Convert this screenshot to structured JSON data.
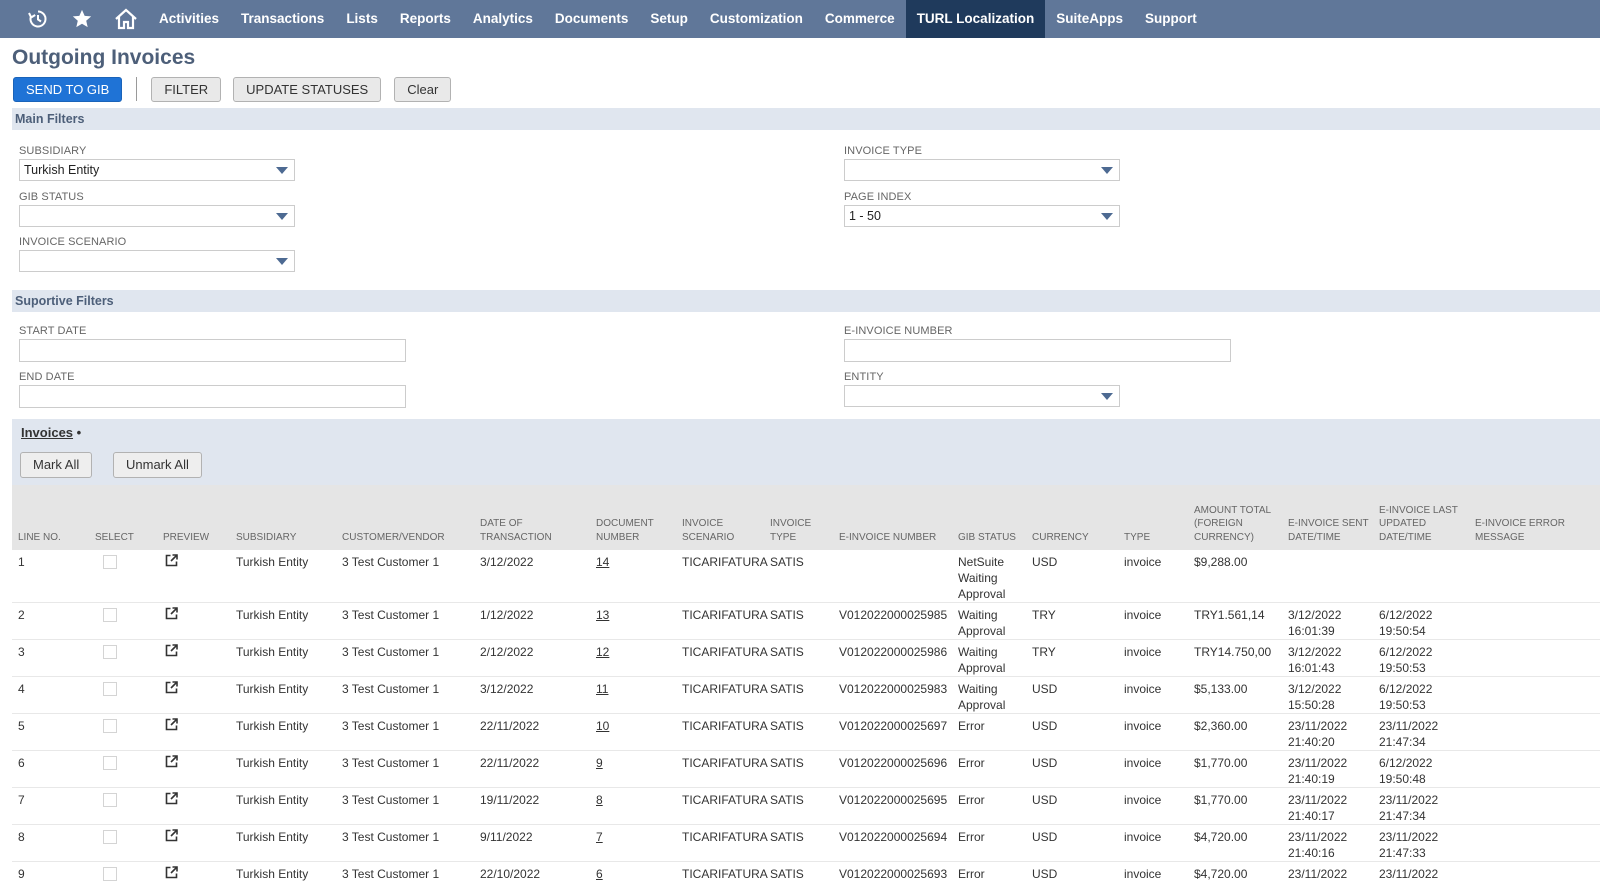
{
  "nav": {
    "items": [
      "Activities",
      "Transactions",
      "Lists",
      "Reports",
      "Analytics",
      "Documents",
      "Setup",
      "Customization",
      "Commerce",
      "TURL Localization",
      "SuiteApps",
      "Support"
    ],
    "active": "TURL Localization"
  },
  "page": {
    "title": "Outgoing Invoices"
  },
  "buttons": {
    "send_to_gib": "SEND TO GIB",
    "filter": "FILTER",
    "update_statuses": "UPDATE STATUSES",
    "clear": "Clear"
  },
  "main_filters": {
    "heading": "Main Filters",
    "subsidiary": {
      "label": "SUBSIDIARY",
      "value": "Turkish Entity"
    },
    "gib_status": {
      "label": "GIB STATUS",
      "value": ""
    },
    "invoice_scenario": {
      "label": "INVOICE SCENARIO",
      "value": ""
    },
    "invoice_type": {
      "label": "INVOICE TYPE",
      "value": ""
    },
    "page_index": {
      "label": "PAGE INDEX",
      "value": "1 - 50"
    }
  },
  "supportive_filters": {
    "heading": "Suportive Filters",
    "start_date": {
      "label": "START DATE",
      "value": ""
    },
    "end_date": {
      "label": "END DATE",
      "value": ""
    },
    "e_invoice_number": {
      "label": "E-INVOICE NUMBER",
      "value": ""
    },
    "entity": {
      "label": "ENTITY",
      "value": ""
    }
  },
  "invoices": {
    "tab_label": "Invoices",
    "tab_marker": "•",
    "mark_all": "Mark All",
    "unmark_all": "Unmark All",
    "columns": [
      "LINE NO.",
      "SELECT",
      "PREVIEW",
      "SUBSIDIARY",
      "CUSTOMER/VENDOR",
      "DATE OF TRANSACTION",
      "DOCUMENT NUMBER",
      "INVOICE SCENARIO",
      "INVOICE TYPE",
      "E-INVOICE NUMBER",
      "GIB STATUS",
      "CURRENCY",
      "TYPE",
      "AMOUNT TOTAL (FOREIGN CURRENCY)",
      "E-INVOICE SENT DATE/TIME",
      "E-INVOICE LAST UPDATED DATE/TIME",
      "E-INVOICE ERROR MESSAGE"
    ],
    "rows": [
      {
        "line": "1",
        "subsidiary": "Turkish Entity",
        "customer": "3 Test Customer 1",
        "date": "3/12/2022",
        "doc": "14",
        "scenario": "TICARIFATURA",
        "type_inv": "SATIS",
        "einv": "",
        "gib": "NetSuite Waiting Approval",
        "currency": "USD",
        "type": "invoice",
        "amount": "$9,288.00",
        "sent": "",
        "updated": "",
        "error": ""
      },
      {
        "line": "2",
        "subsidiary": "Turkish Entity",
        "customer": "3 Test Customer 1",
        "date": "1/12/2022",
        "doc": "13",
        "scenario": "TICARIFATURA",
        "type_inv": "SATIS",
        "einv": "V012022000025985",
        "gib": "Waiting Approval",
        "currency": "TRY",
        "type": "invoice",
        "amount": "TRY1.561,14",
        "sent": "3/12/2022 16:01:39",
        "updated": "6/12/2022 19:50:54",
        "error": ""
      },
      {
        "line": "3",
        "subsidiary": "Turkish Entity",
        "customer": "3 Test Customer 1",
        "date": "2/12/2022",
        "doc": "12",
        "scenario": "TICARIFATURA",
        "type_inv": "SATIS",
        "einv": "V012022000025986",
        "gib": "Waiting Approval",
        "currency": "TRY",
        "type": "invoice",
        "amount": "TRY14.750,00",
        "sent": "3/12/2022 16:01:43",
        "updated": "6/12/2022 19:50:53",
        "error": ""
      },
      {
        "line": "4",
        "subsidiary": "Turkish Entity",
        "customer": "3 Test Customer 1",
        "date": "3/12/2022",
        "doc": "11",
        "scenario": "TICARIFATURA",
        "type_inv": "SATIS",
        "einv": "V012022000025983",
        "gib": "Waiting Approval",
        "currency": "USD",
        "type": "invoice",
        "amount": "$5,133.00",
        "sent": "3/12/2022 15:50:28",
        "updated": "6/12/2022 19:50:53",
        "error": ""
      },
      {
        "line": "5",
        "subsidiary": "Turkish Entity",
        "customer": "3 Test Customer 1",
        "date": "22/11/2022",
        "doc": "10",
        "scenario": "TICARIFATURA",
        "type_inv": "SATIS",
        "einv": "V012022000025697",
        "gib": "Error",
        "currency": "USD",
        "type": "invoice",
        "amount": "$2,360.00",
        "sent": "23/11/2022 21:40:20",
        "updated": "23/11/2022 21:47:34",
        "error": ""
      },
      {
        "line": "6",
        "subsidiary": "Turkish Entity",
        "customer": "3 Test Customer 1",
        "date": "22/11/2022",
        "doc": "9",
        "scenario": "TICARIFATURA",
        "type_inv": "SATIS",
        "einv": "V012022000025696",
        "gib": "Error",
        "currency": "USD",
        "type": "invoice",
        "amount": "$1,770.00",
        "sent": "23/11/2022 21:40:19",
        "updated": "6/12/2022 19:50:48",
        "error": ""
      },
      {
        "line": "7",
        "subsidiary": "Turkish Entity",
        "customer": "3 Test Customer 1",
        "date": "19/11/2022",
        "doc": "8",
        "scenario": "TICARIFATURA",
        "type_inv": "SATIS",
        "einv": "V012022000025695",
        "gib": "Error",
        "currency": "USD",
        "type": "invoice",
        "amount": "$1,770.00",
        "sent": "23/11/2022 21:40:17",
        "updated": "23/11/2022 21:47:34",
        "error": ""
      },
      {
        "line": "8",
        "subsidiary": "Turkish Entity",
        "customer": "3 Test Customer 1",
        "date": "9/11/2022",
        "doc": "7",
        "scenario": "TICARIFATURA",
        "type_inv": "SATIS",
        "einv": "V012022000025694",
        "gib": "Error",
        "currency": "USD",
        "type": "invoice",
        "amount": "$4,720.00",
        "sent": "23/11/2022 21:40:16",
        "updated": "23/11/2022 21:47:33",
        "error": ""
      },
      {
        "line": "9",
        "subsidiary": "Turkish Entity",
        "customer": "3 Test Customer 1",
        "date": "22/10/2022",
        "doc": "6",
        "scenario": "TICARIFATURA",
        "type_inv": "SATIS",
        "einv": "V012022000025693",
        "gib": "Error",
        "currency": "USD",
        "type": "invoice",
        "amount": "$4,720.00",
        "sent": "23/11/2022",
        "updated": "23/11/2022",
        "error": ""
      }
    ]
  },
  "icons": {
    "recent": "recent-records-icon",
    "favorites": "star-icon",
    "home": "home-icon",
    "preview": "open-external-icon"
  },
  "colors": {
    "nav_bg": "#607799",
    "nav_active": "#1f3a5c",
    "primary_button": "#1f73d6",
    "section_bg": "#e0e6ef"
  }
}
